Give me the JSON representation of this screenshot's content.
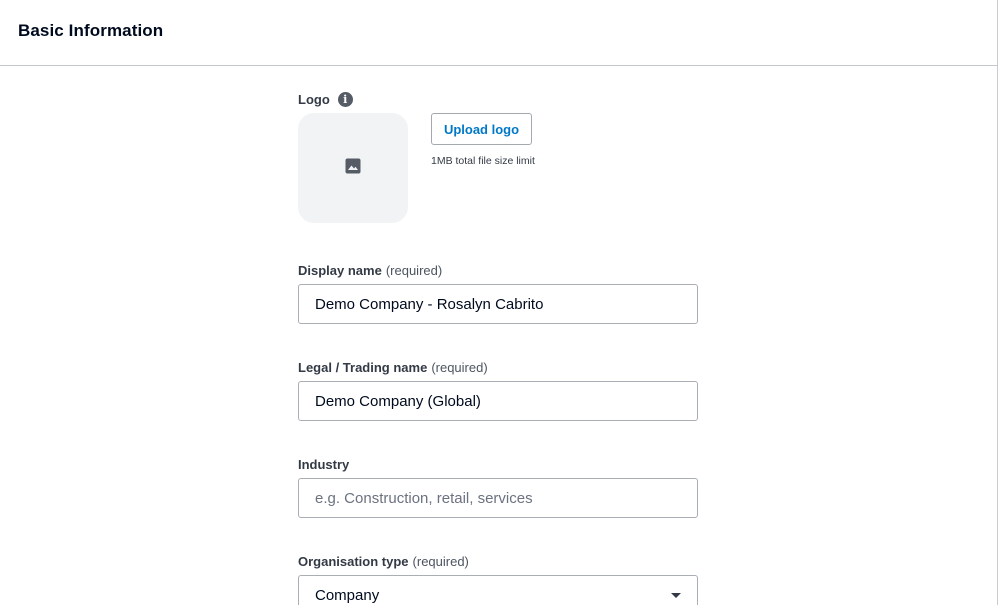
{
  "header": {
    "title": "Basic Information"
  },
  "logo": {
    "label": "Logo",
    "info_icon": "info-icon",
    "placeholder_icon": "image-icon",
    "upload_button": "Upload logo",
    "hint": "1MB total file size limit"
  },
  "fields": {
    "display_name": {
      "label": "Display name",
      "required": "(required)",
      "value": "Demo Company - Rosalyn Cabrito"
    },
    "legal_name": {
      "label": "Legal / Trading name",
      "required": "(required)",
      "value": "Demo Company (Global)"
    },
    "industry": {
      "label": "Industry",
      "placeholder": "e.g. Construction, retail, services"
    },
    "org_type": {
      "label": "Organisation type",
      "required": "(required)",
      "value": "Company",
      "icon": "caret-down-icon"
    }
  },
  "colors": {
    "accent": "#0078c8",
    "border": "#a9aeb5",
    "text": "#000a1e"
  }
}
